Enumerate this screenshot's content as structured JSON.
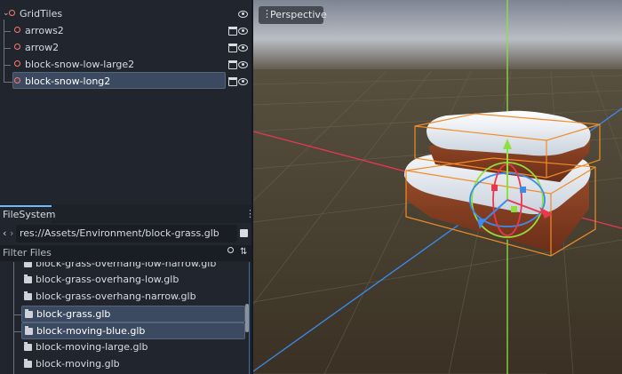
{
  "scene_tree": {
    "root": {
      "label": "GridTiles",
      "icon": "node3d-icon"
    },
    "children": [
      {
        "label": "arrows2",
        "icon": "node3d-icon",
        "selected": false
      },
      {
        "label": "arrow2",
        "icon": "node3d-icon",
        "selected": false
      },
      {
        "label": "block-snow-low-large2",
        "icon": "node3d-icon",
        "selected": false
      },
      {
        "label": "block-snow-long2",
        "icon": "node3d-icon",
        "selected": true
      }
    ]
  },
  "filesystem": {
    "tab_label": "FileSystem",
    "path": "res://Assets/Environment/block-grass.glb",
    "filter_placeholder": "Filter Files",
    "files": [
      {
        "label": "block-grass-overhang-low-narrow.glb",
        "selected": false
      },
      {
        "label": "block-grass-overhang-low.glb",
        "selected": false
      },
      {
        "label": "block-grass-overhang-narrow.glb",
        "selected": false
      },
      {
        "label": "block-grass.glb",
        "selected": true
      },
      {
        "label": "block-moving-blue.glb",
        "selected": true
      },
      {
        "label": "block-moving-large.glb",
        "selected": false
      },
      {
        "label": "block-moving.glb",
        "selected": false
      }
    ]
  },
  "viewport": {
    "view_mode_label": "Perspective"
  },
  "colors": {
    "accent": "#70bafa",
    "node_icon": "#ff786b",
    "selection": "#3b4a60",
    "x_axis": "#e8384f",
    "y_axis": "#8ee03e",
    "z_axis": "#3b8bf0",
    "selection_box": "#f08c28"
  }
}
